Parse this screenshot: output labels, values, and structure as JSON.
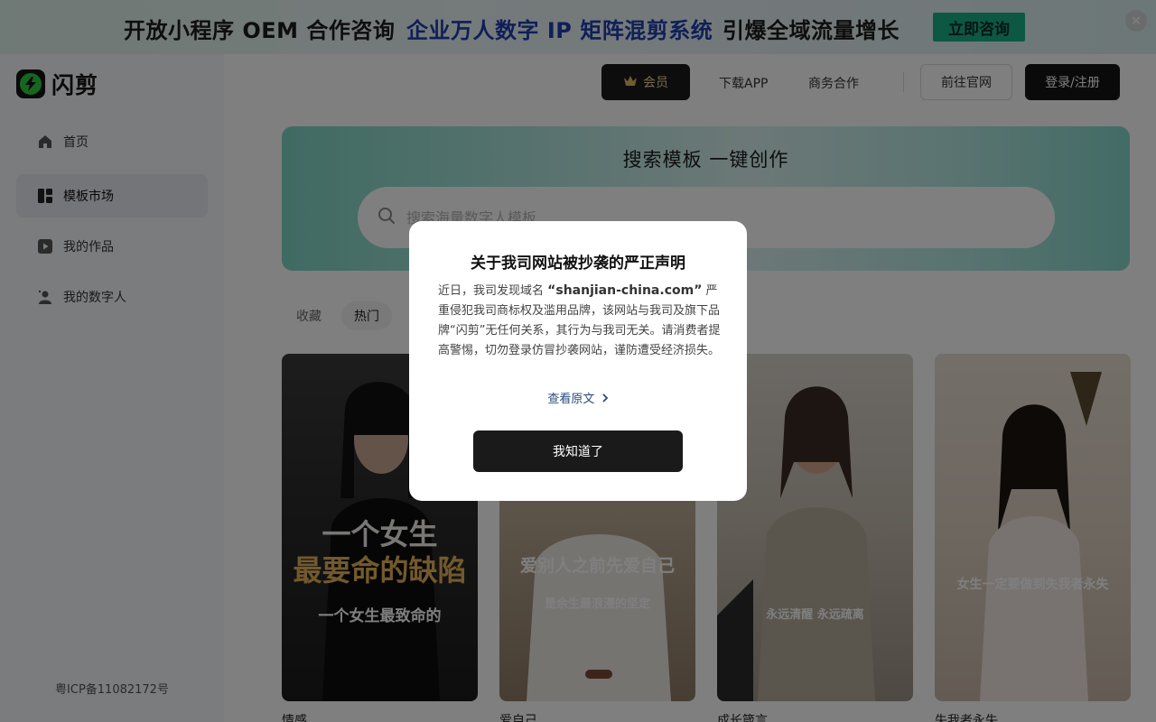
{
  "banner": {
    "part1": "开放小程序 OEM 合作咨询",
    "part2": "企业万人数字 IP 矩阵混剪系统",
    "part3": "引爆全域流量增长",
    "cta": "立即咨询",
    "close": "✕"
  },
  "brand": {
    "name": "闪剪"
  },
  "sidebar": {
    "items": [
      {
        "label": "首页",
        "icon": "home-icon"
      },
      {
        "label": "模板市场",
        "icon": "template-grid-icon",
        "active": true
      },
      {
        "label": "我的作品",
        "icon": "video-play-icon"
      },
      {
        "label": "我的数字人",
        "icon": "digital-human-icon"
      }
    ],
    "icp": "粤ICP备11082172号"
  },
  "header": {
    "vip": "会员",
    "download": "下载APP",
    "business": "商务合作",
    "official": "前往官网",
    "login": "登录/注册"
  },
  "hero": {
    "title": "搜索模板 一键创作",
    "placeholder": "搜索海量数字人模板"
  },
  "tabs": [
    "收藏",
    "热门"
  ],
  "cards": [
    {
      "caption_top_1": "一个女生",
      "caption_top_2": "最要命的缺陷",
      "caption_sub": "一个女生最致命的",
      "title": "情感"
    },
    {
      "caption_top_1": "爱别人之前先爱自己",
      "caption_sub": "是余生最浪漫的坚定",
      "title": "爱自己"
    },
    {
      "caption_sub": "永远清醒 永远疏离",
      "title": "成长箴言"
    },
    {
      "caption_sub": "女生一定要做到失我者永失",
      "title": "失我者永失"
    }
  ],
  "modal": {
    "title": "关于我司网站被抄袭的严正声明",
    "body_prefix": "近日，我司发现域名",
    "domain": "“shanjian-china.com”",
    "body_suffix": "严重侵犯我司商标权及滥用品牌，该网站与我司及旗下品牌“闪剪”无任何关系，其行为与我司无关。请消费者提高警惕，切勿登录仿冒抄袭网站，谨防遭受经济损失。",
    "link": "查看原文",
    "confirm": "我知道了"
  },
  "colors": {
    "banner_cta": "#1ab087",
    "accent_blue": "#1f3fb0",
    "dark": "#141414",
    "vip_gold": "#f5d9a1"
  }
}
